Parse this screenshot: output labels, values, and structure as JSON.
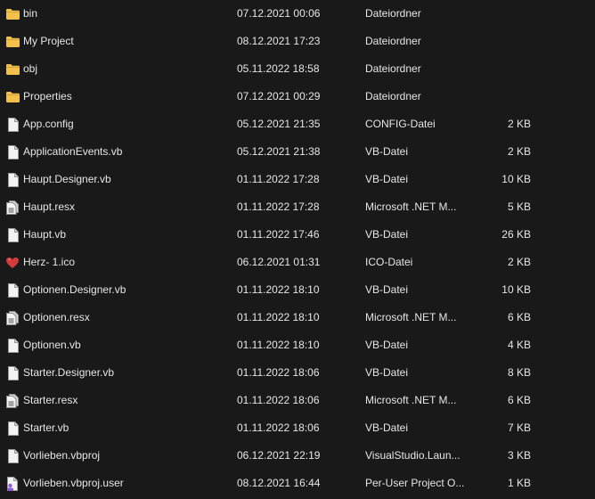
{
  "files": [
    {
      "name": "bin",
      "date": "07.12.2021 00:06",
      "type": "Dateiordner",
      "size": "",
      "icon": "folder-icon"
    },
    {
      "name": "My Project",
      "date": "08.12.2021 17:23",
      "type": "Dateiordner",
      "size": "",
      "icon": "folder-icon"
    },
    {
      "name": "obj",
      "date": "05.11.2022 18:58",
      "type": "Dateiordner",
      "size": "",
      "icon": "folder-icon"
    },
    {
      "name": "Properties",
      "date": "07.12.2021 00:29",
      "type": "Dateiordner",
      "size": "",
      "icon": "folder-icon"
    },
    {
      "name": "App.config",
      "date": "05.12.2021 21:35",
      "type": "CONFIG-Datei",
      "size": "2 KB",
      "icon": "file-icon"
    },
    {
      "name": "ApplicationEvents.vb",
      "date": "05.12.2021 21:38",
      "type": "VB-Datei",
      "size": "2 KB",
      "icon": "file-icon"
    },
    {
      "name": "Haupt.Designer.vb",
      "date": "01.11.2022 17:28",
      "type": "VB-Datei",
      "size": "10 KB",
      "icon": "file-icon"
    },
    {
      "name": "Haupt.resx",
      "date": "01.11.2022 17:28",
      "type": "Microsoft .NET M...",
      "size": "5 KB",
      "icon": "resx-file-icon"
    },
    {
      "name": "Haupt.vb",
      "date": "01.11.2022 17:46",
      "type": "VB-Datei",
      "size": "26 KB",
      "icon": "file-icon"
    },
    {
      "name": "Herz- 1.ico",
      "date": "06.12.2021 01:31",
      "type": "ICO-Datei",
      "size": "2 KB",
      "icon": "heart-icon"
    },
    {
      "name": "Optionen.Designer.vb",
      "date": "01.11.2022 18:10",
      "type": "VB-Datei",
      "size": "10 KB",
      "icon": "file-icon"
    },
    {
      "name": "Optionen.resx",
      "date": "01.11.2022 18:10",
      "type": "Microsoft .NET M...",
      "size": "6 KB",
      "icon": "resx-file-icon"
    },
    {
      "name": "Optionen.vb",
      "date": "01.11.2022 18:10",
      "type": "VB-Datei",
      "size": "4 KB",
      "icon": "file-icon"
    },
    {
      "name": "Starter.Designer.vb",
      "date": "01.11.2022 18:06",
      "type": "VB-Datei",
      "size": "8 KB",
      "icon": "file-icon"
    },
    {
      "name": "Starter.resx",
      "date": "01.11.2022 18:06",
      "type": "Microsoft .NET M...",
      "size": "6 KB",
      "icon": "resx-file-icon"
    },
    {
      "name": "Starter.vb",
      "date": "01.11.2022 18:06",
      "type": "VB-Datei",
      "size": "7 KB",
      "icon": "file-icon"
    },
    {
      "name": "Vorlieben.vbproj",
      "date": "06.12.2021 22:19",
      "type": "VisualStudio.Laun...",
      "size": "3 KB",
      "icon": "file-icon"
    },
    {
      "name": "Vorlieben.vbproj.user",
      "date": "08.12.2021 16:44",
      "type": "Per-User Project O...",
      "size": "1 KB",
      "icon": "user-file-icon"
    }
  ],
  "colors": {
    "background": "#191919",
    "text": "#e6e6e6",
    "folder": "#f2c14b",
    "file": "#f3f3f3",
    "heart": "#d13b3b"
  }
}
